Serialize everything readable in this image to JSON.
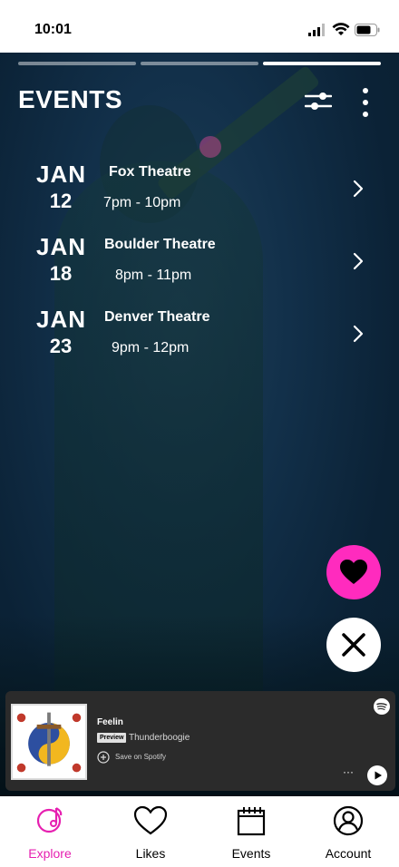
{
  "status_bar": {
    "time": "10:01"
  },
  "header": {
    "title": "EVENTS"
  },
  "events": [
    {
      "month": "JAN",
      "day": "12",
      "venue": "Fox Theatre",
      "time": "7pm - 10pm"
    },
    {
      "month": "JAN",
      "day": "18",
      "venue": "Boulder Theatre",
      "time": "8pm - 11pm"
    },
    {
      "month": "JAN",
      "day": "23",
      "venue": "Denver Theatre",
      "time": "9pm - 12pm"
    }
  ],
  "story_progress": {
    "segments": 3,
    "active_index": 2
  },
  "player": {
    "track": "Feelin",
    "badge": "Preview",
    "artist": "Thunderboogie",
    "save_label": "Save on Spotify",
    "more_label": "···"
  },
  "nav": [
    {
      "label": "Explore",
      "icon": "explore-icon",
      "active": true
    },
    {
      "label": "Likes",
      "icon": "heart-icon",
      "active": false
    },
    {
      "label": "Events",
      "icon": "calendar-icon",
      "active": false
    },
    {
      "label": "Account",
      "icon": "account-icon",
      "active": false
    }
  ],
  "colors": {
    "accent": "#ff2bbe",
    "nav_active": "#e61fb0",
    "player_bg": "#2b2b2b"
  }
}
